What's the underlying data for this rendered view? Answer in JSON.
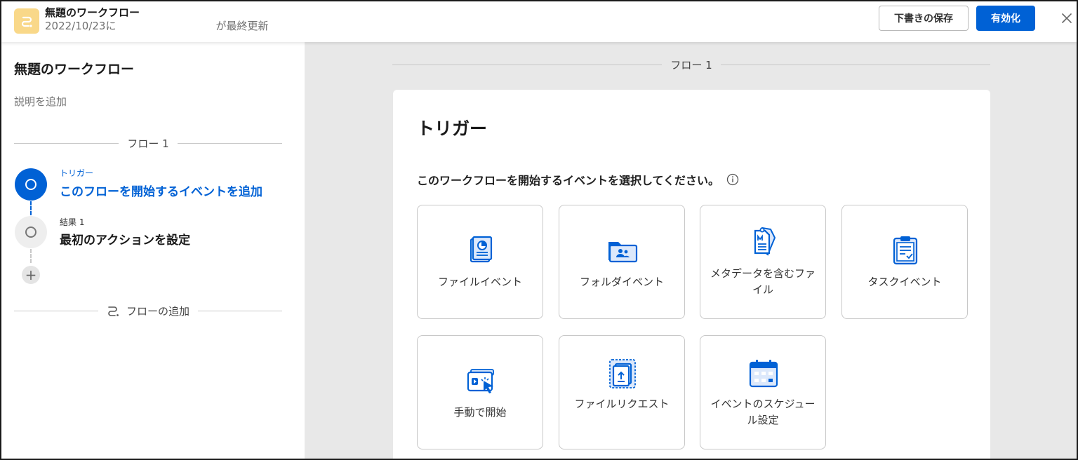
{
  "header": {
    "workflow_title": "無題のワークフロー",
    "updated_date": "2022/10/23に",
    "updated_suffix": "が最終更新",
    "save_draft_label": "下書きの保存",
    "enable_label": "有効化",
    "app_icon": "workflow-icon",
    "close_icon": "close-icon"
  },
  "sidebar": {
    "title": "無題のワークフロー",
    "description_placeholder": "説明を追加",
    "flow_label": "フロー 1",
    "steps": [
      {
        "small": "トリガー",
        "label": "このフローを開始するイベントを追加",
        "active": true
      },
      {
        "small": "結果 1",
        "label": "最初のアクションを設定",
        "active": false
      }
    ],
    "add_flow_label": "フローの追加"
  },
  "main": {
    "flow_label": "フロー 1",
    "card": {
      "title": "トリガー",
      "prompt": "このワークフローを開始するイベントを選択してください。",
      "tiles": [
        {
          "label": "ファイルイベント",
          "icon": "file-event-icon"
        },
        {
          "label": "フォルダイベント",
          "icon": "folder-event-icon"
        },
        {
          "label": "メタデータを含むファイル",
          "icon": "metadata-file-icon"
        },
        {
          "label": "タスクイベント",
          "icon": "task-event-icon"
        },
        {
          "label": "手動で開始",
          "icon": "manual-start-icon"
        },
        {
          "label": "ファイルリクエスト",
          "icon": "file-request-icon"
        },
        {
          "label": "イベントのスケジュール設定",
          "icon": "schedule-event-icon"
        }
      ]
    }
  },
  "colors": {
    "accent": "#0061d5",
    "app_icon_bg": "#f9d889",
    "canvas_bg": "#e8e8e8"
  }
}
